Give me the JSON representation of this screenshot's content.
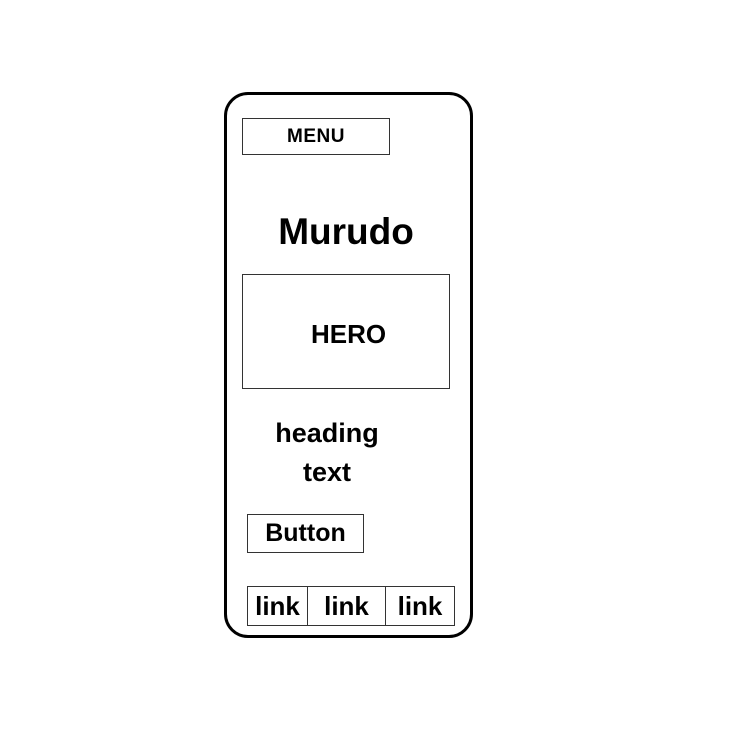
{
  "header": {
    "menu_label": "MENU"
  },
  "brand": {
    "title": "Murudo"
  },
  "hero": {
    "label": "HERO"
  },
  "content": {
    "heading_line1": "heading",
    "heading_line2": "text",
    "button_label": "Button"
  },
  "footer": {
    "links": [
      {
        "label": "link"
      },
      {
        "label": "link"
      },
      {
        "label": "link"
      }
    ]
  },
  "colors": {
    "background": "#ffffff",
    "stroke": "#000000",
    "box_border": "#333333"
  }
}
